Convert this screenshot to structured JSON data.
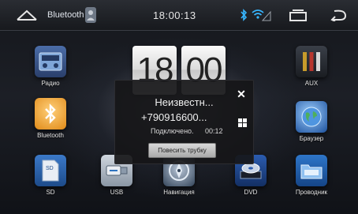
{
  "statusbar": {
    "bluetooth_label": "Bluetooth",
    "time": "18:00:13",
    "bluetooth_symbol": "ʙ"
  },
  "clock": {
    "hours": "18",
    "minutes": "00"
  },
  "apps": {
    "radio": "Радио",
    "bluetooth": "Bluetooth",
    "sd": "SD",
    "usb": "USB",
    "navigation": "Навигация",
    "dvd": "DVD",
    "explorer": "Проводник",
    "aux": "AUX",
    "browser": "Браузер"
  },
  "call_dialog": {
    "caller_name": "Неизвестн...",
    "caller_number": "+790916600...",
    "status": "Подключено.",
    "duration": "00:12",
    "hangup_label": "Повесить трубку"
  },
  "colors": {
    "accent_blue": "#37b6ff",
    "bar_top": "#2a2d33"
  }
}
